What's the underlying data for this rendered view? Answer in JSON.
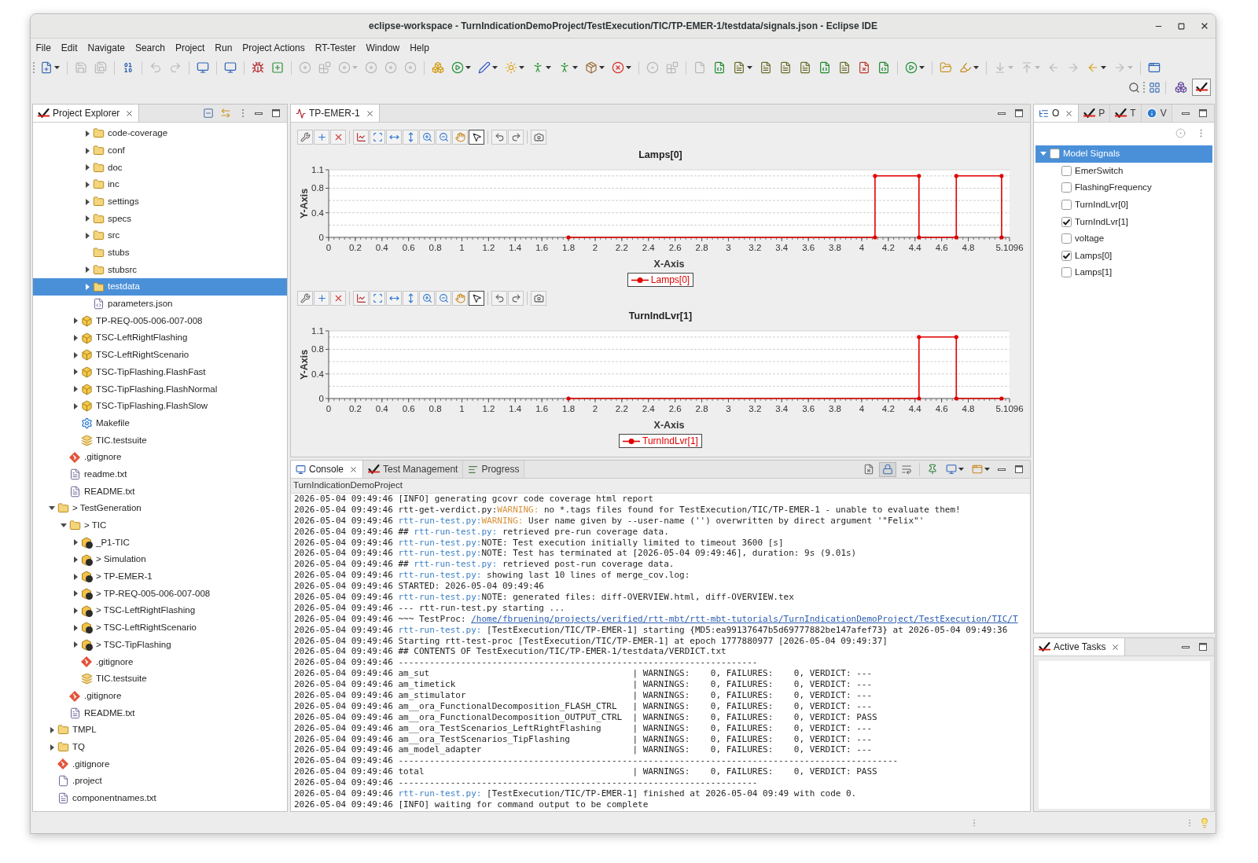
{
  "window": {
    "title": "eclipse-workspace - TurnIndicationDemoProject/TestExecution/TIC/TP-EMER-1/testdata/signals.json - Eclipse IDE"
  },
  "menu": [
    "File",
    "Edit",
    "Navigate",
    "Search",
    "Project",
    "Run",
    "Project Actions",
    "RT-Tester",
    "Window",
    "Help"
  ],
  "toolbar": [
    [
      {
        "kind": "new",
        "disabled": false,
        "menu": true
      }
    ],
    [
      {
        "kind": "save",
        "disabled": true,
        "menu": false
      },
      {
        "kind": "save-all",
        "disabled": true,
        "menu": false
      }
    ],
    [
      {
        "kind": "binary",
        "disabled": false,
        "menu": false
      }
    ],
    [
      {
        "kind": "undo",
        "disabled": true,
        "menu": false
      },
      {
        "kind": "redo",
        "disabled": true,
        "menu": false
      }
    ],
    [
      {
        "kind": "monitor",
        "disabled": false,
        "menu": false
      }
    ],
    [
      {
        "kind": "monitor",
        "disabled": false,
        "menu": false
      }
    ],
    [
      {
        "kind": "bug",
        "disabled": false,
        "menu": false
      },
      {
        "kind": "add",
        "disabled": false,
        "menu": false
      }
    ],
    [
      {
        "kind": "disc",
        "disabled": true,
        "menu": false
      },
      {
        "kind": "blocks",
        "disabled": true,
        "menu": false
      },
      {
        "kind": "disc",
        "disabled": true,
        "menu": true
      },
      {
        "kind": "disc",
        "disabled": true,
        "menu": false
      },
      {
        "kind": "disc",
        "disabled": true,
        "menu": false
      },
      {
        "kind": "disc",
        "disabled": true,
        "menu": false
      }
    ],
    [
      {
        "kind": "boxes",
        "disabled": false,
        "menu": false
      },
      {
        "kind": "run",
        "disabled": false,
        "menu": true
      },
      {
        "kind": "pen",
        "disabled": false,
        "menu": true
      },
      {
        "kind": "sun",
        "disabled": false,
        "menu": true
      },
      {
        "kind": "person",
        "disabled": false,
        "menu": true
      },
      {
        "kind": "person",
        "disabled": false,
        "menu": true
      },
      {
        "kind": "package",
        "disabled": false,
        "menu": true
      },
      {
        "kind": "stop",
        "disabled": false,
        "menu": true
      }
    ],
    [
      {
        "kind": "radio",
        "disabled": true,
        "menu": false
      },
      {
        "kind": "blocks",
        "disabled": true,
        "menu": false
      }
    ],
    [
      {
        "kind": "file",
        "disabled": true,
        "menu": false
      },
      {
        "kind": "file-code",
        "disabled": false,
        "menu": false
      },
      {
        "kind": "file-text",
        "disabled": false,
        "menu": true
      },
      {
        "kind": "file-text",
        "disabled": false,
        "menu": false
      },
      {
        "kind": "file-text",
        "disabled": false,
        "menu": false
      },
      {
        "kind": "file-text",
        "disabled": false,
        "menu": false
      },
      {
        "kind": "file-code",
        "disabled": false,
        "menu": false
      },
      {
        "kind": "file-text",
        "disabled": false,
        "menu": false
      },
      {
        "kind": "file-x",
        "disabled": false,
        "menu": false
      },
      {
        "kind": "file-code",
        "disabled": false,
        "menu": false
      }
    ],
    [
      {
        "kind": "run",
        "disabled": false,
        "menu": true
      }
    ],
    [
      {
        "kind": "folder-open",
        "disabled": false,
        "menu": false
      },
      {
        "kind": "highlighter",
        "disabled": false,
        "menu": true
      }
    ],
    [
      {
        "kind": "arrow-down",
        "disabled": true,
        "menu": true
      },
      {
        "kind": "arrow-up",
        "disabled": true,
        "menu": true
      },
      {
        "kind": "arrow-left",
        "disabled": true,
        "menu": false
      },
      {
        "kind": "arrow-right",
        "disabled": true,
        "menu": false
      },
      {
        "kind": "arrow-left",
        "disabled": false,
        "menu": true
      },
      {
        "kind": "arrow-right",
        "disabled": true,
        "menu": true
      }
    ],
    [
      {
        "kind": "window",
        "disabled": false,
        "menu": false
      }
    ]
  ],
  "perspectives": [
    {
      "kind": "java",
      "selected": false
    },
    {
      "kind": "rt-tester",
      "selected": true
    }
  ],
  "project_explorer": {
    "tabs": [
      {
        "label": "Project Explorer",
        "kind": "rt-tester",
        "selected": true
      }
    ],
    "tree": [
      {
        "children": [
          {
            "children": [
              {
                "children": [
                  {
                    "label": "code-coverage",
                    "kind": "folder",
                    "expanded": false,
                    "selected": false
                  },
                  {
                    "label": "conf",
                    "kind": "folder",
                    "expanded": false,
                    "selected": false
                  },
                  {
                    "label": "doc",
                    "kind": "folder",
                    "expanded": false,
                    "selected": false
                  },
                  {
                    "label": "inc",
                    "kind": "folder",
                    "expanded": false,
                    "selected": false
                  },
                  {
                    "label": "settings",
                    "kind": "folder",
                    "expanded": false,
                    "selected": false
                  },
                  {
                    "label": "specs",
                    "kind": "folder",
                    "expanded": false,
                    "selected": false
                  },
                  {
                    "label": "src",
                    "kind": "folder",
                    "expanded": false,
                    "selected": false
                  },
                  {
                    "label": "stubs",
                    "kind": "folder",
                    "selected": false
                  },
                  {
                    "label": "stubsrc",
                    "kind": "folder",
                    "expanded": false,
                    "selected": false
                  },
                  {
                    "label": "testdata",
                    "kind": "folder",
                    "expanded": false,
                    "selected": true
                  },
                  {
                    "label": "parameters.json",
                    "kind": "json-file",
                    "selected": false
                  }
                ]
              },
              {
                "label": "TP-REQ-005-006-007-008",
                "kind": "procedure",
                "expanded": false,
                "selected": false
              },
              {
                "label": "TSC-LeftRightFlashing",
                "kind": "procedure",
                "expanded": false,
                "selected": false
              },
              {
                "label": "TSC-LeftRightScenario",
                "kind": "procedure",
                "expanded": false,
                "selected": false
              },
              {
                "label": "TSC-TipFlashing.FlashFast",
                "kind": "procedure",
                "expanded": false,
                "selected": false
              },
              {
                "label": "TSC-TipFlashing.FlashNormal",
                "kind": "procedure",
                "expanded": false,
                "selected": false
              },
              {
                "label": "TSC-TipFlashing.FlashSlow",
                "kind": "procedure",
                "expanded": false,
                "selected": false
              },
              {
                "label": "Makefile",
                "kind": "makefile",
                "selected": false
              },
              {
                "label": "TIC.testsuite",
                "kind": "testsuite",
                "selected": false
              }
            ]
          },
          {
            "label": ".gitignore",
            "kind": "git",
            "selected": false
          },
          {
            "label": "readme.txt",
            "kind": "text-file",
            "selected": false
          },
          {
            "label": "README.txt",
            "kind": "text-file",
            "selected": false
          }
        ]
      },
      {
        "label": "> TestGeneration",
        "kind": "folder",
        "expanded": true,
        "selected": false,
        "children": [
          {
            "label": "> TIC",
            "kind": "folder",
            "expanded": true,
            "selected": false,
            "children": [
              {
                "label": "_P1-TIC",
                "kind": "model",
                "expanded": false,
                "selected": false
              },
              {
                "label": "> Simulation",
                "kind": "model",
                "expanded": false,
                "selected": false
              },
              {
                "label": "> TP-EMER-1",
                "kind": "model",
                "expanded": false,
                "selected": false
              },
              {
                "label": "> TP-REQ-005-006-007-008",
                "kind": "model",
                "expanded": false,
                "selected": false
              },
              {
                "label": "> TSC-LeftRightFlashing",
                "kind": "model",
                "expanded": false,
                "selected": false
              },
              {
                "label": "> TSC-LeftRightScenario",
                "kind": "model",
                "expanded": false,
                "selected": false
              },
              {
                "label": "> TSC-TipFlashing",
                "kind": "model",
                "expanded": false,
                "selected": false
              },
              {
                "label": ".gitignore",
                "kind": "git",
                "selected": false
              },
              {
                "label": "TIC.testsuite",
                "kind": "testsuite",
                "selected": false
              }
            ]
          },
          {
            "label": ".gitignore",
            "kind": "git",
            "selected": false
          },
          {
            "label": "README.txt",
            "kind": "text-file",
            "selected": false
          }
        ]
      },
      {
        "label": "TMPL",
        "kind": "folder",
        "expanded": false,
        "selected": false
      },
      {
        "label": "TQ",
        "kind": "folder",
        "expanded": false,
        "selected": false
      },
      {
        "label": ".gitignore",
        "kind": "git",
        "selected": false
      },
      {
        "label": ".project",
        "kind": "project-file",
        "selected": false
      },
      {
        "label": "componentnames.txt",
        "kind": "text-file",
        "selected": false
      }
    ]
  },
  "editor": {
    "tabs": [
      {
        "label": "TP-EMER-1",
        "kind": "chart",
        "selected": true
      }
    ],
    "charts": [
      {
        "tools": [
          [
            {
              "kind": "configure",
              "selected": false
            },
            {
              "kind": "add-marker",
              "selected": false
            },
            {
              "kind": "remove-marker",
              "selected": false
            }
          ],
          [
            {
              "kind": "axis",
              "selected": false
            },
            {
              "kind": "zoom-box",
              "selected": false
            },
            {
              "kind": "zoom-x",
              "selected": false
            },
            {
              "kind": "zoom-y",
              "selected": false
            },
            {
              "kind": "zoom-in",
              "selected": false
            },
            {
              "kind": "zoom-out",
              "selected": false
            },
            {
              "kind": "pan",
              "selected": false
            },
            {
              "kind": "pointer",
              "selected": true
            }
          ],
          [
            {
              "kind": "undo",
              "selected": false
            },
            {
              "kind": "redo",
              "selected": false
            }
          ],
          [
            {
              "kind": "snapshot",
              "selected": false
            }
          ]
        ],
        "chart_data": {
          "type": "line",
          "title": "Lamps[0]",
          "xlabel": "X-Axis",
          "ylabel": "Y-Axis",
          "x": [
            1.8,
            4.1,
            4.1,
            4.43,
            4.43,
            4.71,
            4.71,
            5.05,
            5.05
          ],
          "series": [
            {
              "name": "Lamps[0]",
              "color": "#e00000",
              "values": [
                0,
                0,
                1,
                1,
                0,
                0,
                1,
                1,
                0
              ]
            }
          ],
          "xlim": [
            0,
            5.1096
          ],
          "ylim": [
            0,
            1.1
          ],
          "xticks": [
            0,
            0.2,
            0.4,
            0.6,
            0.8,
            1,
            1.2,
            1.4,
            1.6,
            1.8,
            2,
            2.2,
            2.4,
            2.6,
            2.8,
            3,
            3.2,
            3.4,
            3.6,
            3.8,
            4,
            4.2,
            4.4,
            4.6,
            4.8,
            5.1096
          ],
          "yticks": [
            0,
            0.4,
            0.8,
            1.1
          ]
        }
      },
      {
        "tools": [
          [
            {
              "kind": "configure",
              "selected": false
            },
            {
              "kind": "add-marker",
              "selected": false
            },
            {
              "kind": "remove-marker",
              "selected": false
            }
          ],
          [
            {
              "kind": "axis",
              "selected": false
            },
            {
              "kind": "zoom-box",
              "selected": false
            },
            {
              "kind": "zoom-x",
              "selected": false
            },
            {
              "kind": "zoom-y",
              "selected": false
            },
            {
              "kind": "zoom-in",
              "selected": false
            },
            {
              "kind": "zoom-out",
              "selected": false
            },
            {
              "kind": "pan",
              "selected": false
            },
            {
              "kind": "pointer",
              "selected": true
            }
          ],
          [
            {
              "kind": "undo",
              "selected": false
            },
            {
              "kind": "redo",
              "selected": false
            }
          ],
          [
            {
              "kind": "snapshot",
              "selected": false
            }
          ]
        ],
        "chart_data": {
          "type": "line",
          "title": "TurnIndLvr[1]",
          "xlabel": "X-Axis",
          "ylabel": "Y-Axis",
          "x": [
            1.8,
            4.43,
            4.43,
            4.71,
            4.71,
            5.05
          ],
          "series": [
            {
              "name": "TurnIndLvr[1]",
              "color": "#e00000",
              "values": [
                0,
                0,
                1,
                1,
                0,
                0
              ]
            }
          ],
          "xlim": [
            0,
            5.1096
          ],
          "ylim": [
            0,
            1.1
          ],
          "xticks": [
            0,
            0.2,
            0.4,
            0.6,
            0.8,
            1,
            1.2,
            1.4,
            1.6,
            1.8,
            2,
            2.2,
            2.4,
            2.6,
            2.8,
            3,
            3.2,
            3.4,
            3.6,
            3.8,
            4,
            4.2,
            4.4,
            4.6,
            4.8,
            5.1096
          ],
          "yticks": [
            0,
            0.4,
            0.8,
            1.1
          ]
        }
      }
    ]
  },
  "console_view": {
    "tabs": [
      {
        "label": "Console",
        "kind": "console",
        "selected": true
      },
      {
        "label": "Test Management",
        "kind": "rt-tester",
        "selected": false
      },
      {
        "label": "Progress",
        "kind": "progress",
        "selected": false
      }
    ],
    "tools": [
      [
        {
          "kind": "clear",
          "selected": false,
          "menu": false
        },
        {
          "kind": "scroll-lock",
          "selected": true,
          "menu": false
        },
        {
          "kind": "word-wrap",
          "selected": false,
          "menu": false
        }
      ],
      [
        {
          "kind": "pin",
          "selected": false,
          "menu": false
        },
        {
          "kind": "display",
          "selected": false,
          "menu": true
        },
        {
          "kind": "open",
          "selected": false,
          "menu": true
        }
      ]
    ],
    "project": "TurnIndicationDemoProject",
    "lines": [
      {
        "segments": [
          {
            "text": "2026-05-04 09:49:46 [INFO] generating gcovr code coverage html report",
            "kind": "plain"
          }
        ]
      },
      {
        "segments": [
          {
            "text": "2026-05-04 09:49:46 rtt-get-verdict.py:",
            "kind": "plain"
          },
          {
            "text": "WARNING:",
            "kind": "warning"
          },
          {
            "text": " no *.tags files found for TestExecution/TIC/TP-EMER-1 - unable to evaluate them!",
            "kind": "plain"
          }
        ]
      },
      {
        "segments": [
          {
            "text": "2026-05-04 09:49:46 ",
            "kind": "plain"
          },
          {
            "text": "rtt-run-test.py:",
            "kind": "source"
          },
          {
            "text": "WARNING:",
            "kind": "warning"
          },
          {
            "text": " User name given by --user-name ('') overwritten by direct argument '\"Felix\"'",
            "kind": "plain"
          }
        ]
      },
      {
        "segments": [
          {
            "text": "2026-05-04 09:49:46 ## ",
            "kind": "plain"
          },
          {
            "text": "rtt-run-test.py:",
            "kind": "source"
          },
          {
            "text": " retrieved pre-run coverage data.",
            "kind": "plain"
          }
        ]
      },
      {
        "segments": [
          {
            "text": "2026-05-04 09:49:46 ",
            "kind": "plain"
          },
          {
            "text": "rtt-run-test.py:",
            "kind": "source"
          },
          {
            "text": "NOTE: Test execution initially limited to timeout 3600 [s]",
            "kind": "plain"
          }
        ]
      },
      {
        "segments": [
          {
            "text": "2026-05-04 09:49:46 ",
            "kind": "plain"
          },
          {
            "text": "rtt-run-test.py:",
            "kind": "source"
          },
          {
            "text": "NOTE: Test has terminated at [2026-05-04 09:49:46], duration: 9s (9.01s)",
            "kind": "plain"
          }
        ]
      },
      {
        "segments": [
          {
            "text": "2026-05-04 09:49:46 ## ",
            "kind": "plain"
          },
          {
            "text": "rtt-run-test.py:",
            "kind": "source"
          },
          {
            "text": " retrieved post-run coverage data.",
            "kind": "plain"
          }
        ]
      },
      {
        "segments": [
          {
            "text": "2026-05-04 09:49:46 ",
            "kind": "plain"
          },
          {
            "text": "rtt-run-test.py:",
            "kind": "source"
          },
          {
            "text": " showing last 10 lines of merge_cov.log:",
            "kind": "plain"
          }
        ]
      },
      {
        "segments": [
          {
            "text": "2026-05-04 09:49:46 STARTED: 2026-05-04 09:49:46",
            "kind": "plain"
          }
        ]
      },
      {
        "segments": [
          {
            "text": "2026-05-04 09:49:46 ",
            "kind": "plain"
          },
          {
            "text": "rtt-run-test.py:",
            "kind": "source"
          },
          {
            "text": "NOTE: generated files: diff-OVERVIEW.html, diff-OVERVIEW.tex",
            "kind": "plain"
          }
        ]
      },
      {
        "segments": [
          {
            "text": "2026-05-04 09:49:46 --- rtt-run-test.py starting ...",
            "kind": "plain"
          }
        ]
      },
      {
        "segments": [
          {
            "text": "2026-05-04 09:49:46 ~~~ TestProc: ",
            "kind": "plain"
          },
          {
            "text": "/home/fbruening/projects/verified/rtt-mbt/rtt-mbt-tutorials/TurnIndicationDemoProject/TestExecution/TIC/T",
            "kind": "link"
          }
        ]
      },
      {
        "segments": [
          {
            "text": "2026-05-04 09:49:46 ",
            "kind": "plain"
          },
          {
            "text": "rtt-run-test.py:",
            "kind": "source"
          },
          {
            "text": " [TestExecution/TIC/TP-EMER-1] starting {MD5:ea99137647b5d69777882be147afef73} at 2026-05-04 09:49:36",
            "kind": "plain"
          }
        ]
      },
      {
        "segments": [
          {
            "text": "2026-05-04 09:49:46 Starting rtt-test-proc [TestExecution/TIC/TP-EMER-1] at epoch 1777880977 [2026-05-04 09:49:37]",
            "kind": "plain"
          }
        ]
      },
      {
        "segments": [
          {
            "text": "2026-05-04 09:49:46 ## CONTENTS OF TestExecution/TIC/TP-EMER-1/testdata/VERDICT.txt",
            "kind": "plain"
          }
        ]
      },
      {
        "segments": [
          {
            "text": "2026-05-04 09:49:46 ---------------------------------------------------------------------",
            "kind": "plain"
          }
        ]
      },
      {
        "segments": [
          {
            "text": "2026-05-04 09:49:46 am_sut                                       | WARNINGS:    0, FAILURES:    0, VERDICT: ---",
            "kind": "plain"
          }
        ]
      },
      {
        "segments": [
          {
            "text": "2026-05-04 09:49:46 am_timetick                                  | WARNINGS:    0, FAILURES:    0, VERDICT: ---",
            "kind": "plain"
          }
        ]
      },
      {
        "segments": [
          {
            "text": "2026-05-04 09:49:46 am_stimulator                                | WARNINGS:    0, FAILURES:    0, VERDICT: ---",
            "kind": "plain"
          }
        ]
      },
      {
        "segments": [
          {
            "text": "2026-05-04 09:49:46 am__ora_FunctionalDecomposition_FLASH_CTRL   | WARNINGS:    0, FAILURES:    0, VERDICT: ---",
            "kind": "plain"
          }
        ]
      },
      {
        "segments": [
          {
            "text": "2026-05-04 09:49:46 am__ora_FunctionalDecomposition_OUTPUT_CTRL  | WARNINGS:    0, FAILURES:    0, VERDICT: PASS",
            "kind": "plain"
          }
        ]
      },
      {
        "segments": [
          {
            "text": "2026-05-04 09:49:46 am__ora_TestScenarios_LeftRightFlashing      | WARNINGS:    0, FAILURES:    0, VERDICT: ---",
            "kind": "plain"
          }
        ]
      },
      {
        "segments": [
          {
            "text": "2026-05-04 09:49:46 am__ora_TestScenarios_TipFlashing            | WARNINGS:    0, FAILURES:    0, VERDICT: ---",
            "kind": "plain"
          }
        ]
      },
      {
        "segments": [
          {
            "text": "2026-05-04 09:49:46 am_model_adapter                             | WARNINGS:    0, FAILURES:    0, VERDICT: ---",
            "kind": "plain"
          }
        ]
      },
      {
        "segments": [
          {
            "text": "2026-05-04 09:49:46 ------------------------------------------------------------------------------------------------",
            "kind": "plain"
          }
        ]
      },
      {
        "segments": [
          {
            "text": "2026-05-04 09:49:46 total                                        | WARNINGS:    0, FAILURES:    0, VERDICT: PASS",
            "kind": "plain"
          }
        ]
      },
      {
        "segments": [
          {
            "text": "2026-05-04 09:49:46 ---------------------------------------------------------------------",
            "kind": "plain"
          }
        ]
      },
      {
        "segments": [
          {
            "text": "2026-05-04 09:49:46 ",
            "kind": "plain"
          },
          {
            "text": "rtt-run-test.py:",
            "kind": "source"
          },
          {
            "text": " [TestExecution/TIC/TP-EMER-1] finished at 2026-05-04 09:49 with code 0.",
            "kind": "plain"
          }
        ]
      },
      {
        "segments": [
          {
            "text": "2026-05-04 09:49:46 [INFO] waiting for command output to be complete",
            "kind": "plain"
          }
        ]
      }
    ]
  },
  "signals_view": {
    "tabs": [
      {
        "label": "O",
        "kind": "outline",
        "selected": true
      },
      {
        "label": "P",
        "kind": "rt-tester",
        "selected": false
      },
      {
        "label": "T",
        "kind": "rt-tester",
        "selected": false
      },
      {
        "label": "V",
        "kind": "info",
        "selected": false
      }
    ],
    "tree": [
      {
        "label": "Model Signals",
        "expanded": true,
        "checked": false,
        "selected": true,
        "children": [
          {
            "label": "EmerSwitch",
            "checked": false,
            "selected": false
          },
          {
            "label": "FlashingFrequency",
            "checked": false,
            "selected": false
          },
          {
            "label": "TurnIndLvr[0]",
            "checked": false,
            "selected": false
          },
          {
            "label": "TurnIndLvr[1]",
            "checked": true,
            "selected": false
          },
          {
            "label": "voltage",
            "checked": false,
            "selected": false
          },
          {
            "label": "Lamps[0]",
            "checked": true,
            "selected": false
          },
          {
            "label": "Lamps[1]",
            "checked": false,
            "selected": false
          }
        ]
      }
    ]
  },
  "active_tasks": {
    "tabs": [
      {
        "label": "Active Tasks",
        "kind": "rt-tester",
        "selected": true
      }
    ]
  }
}
